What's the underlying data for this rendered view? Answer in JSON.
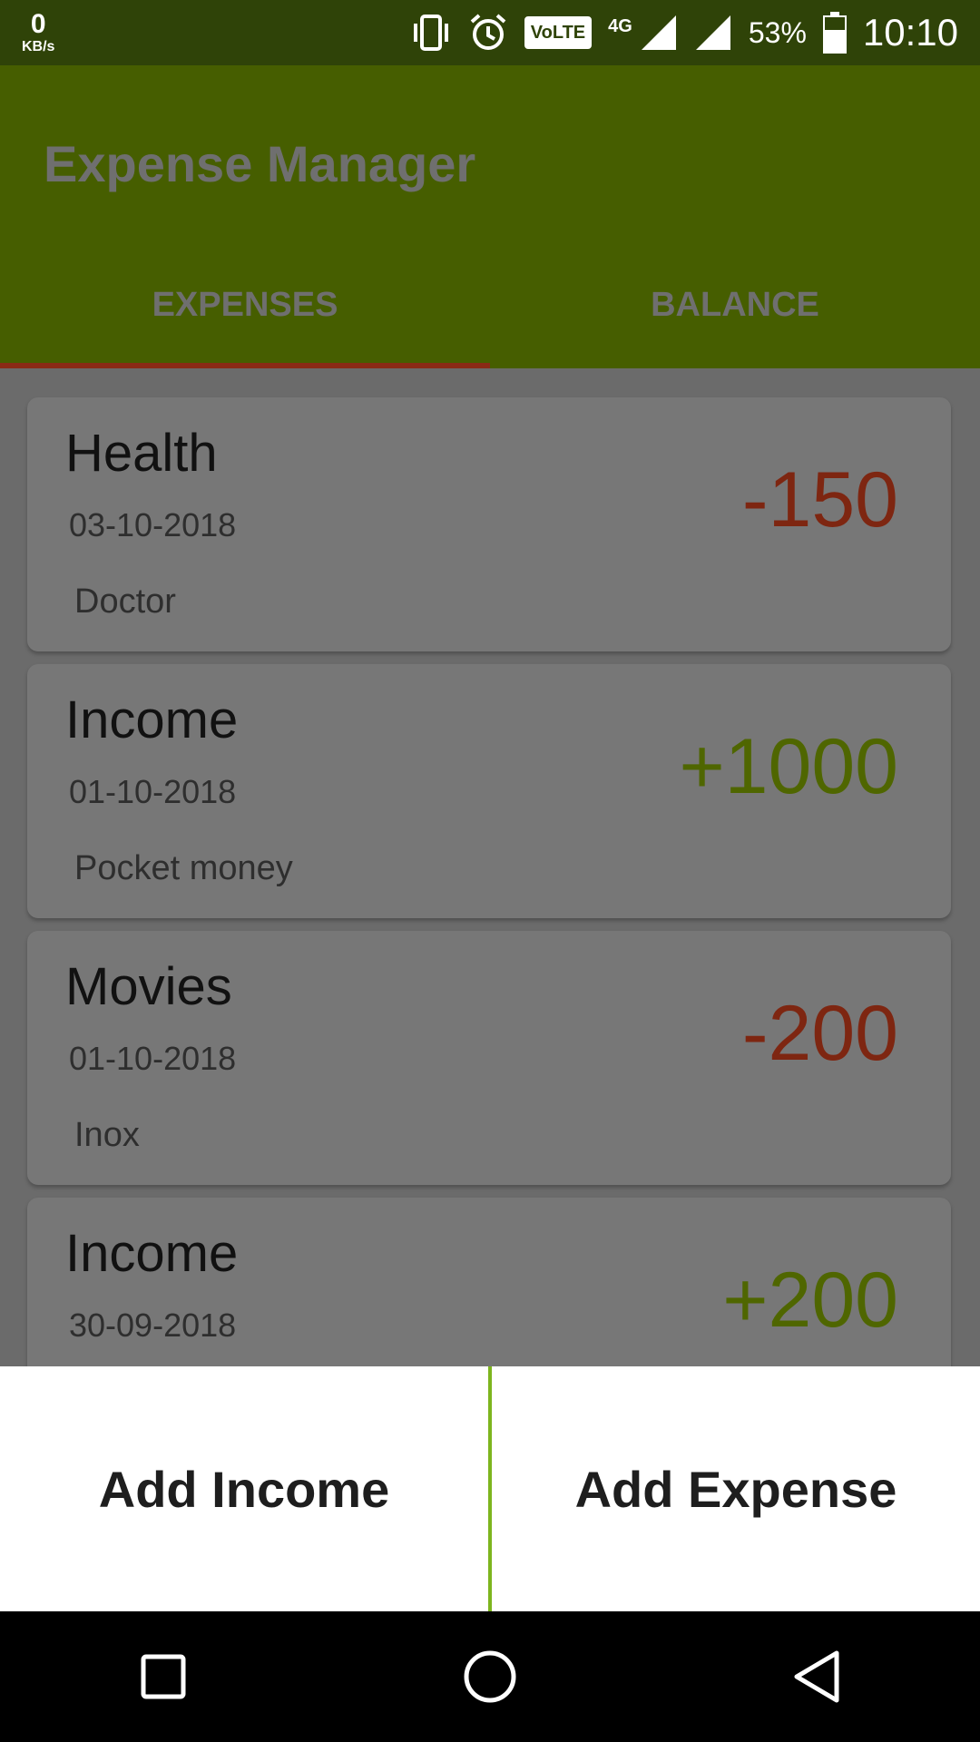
{
  "status_bar": {
    "net_speed": "0",
    "net_unit": "KB/s",
    "volte": "VoLTE",
    "network_type": "4G",
    "battery_percent": "53%",
    "time": "10:10",
    "icons": [
      "vibrate-icon",
      "alarm-icon",
      "volte-icon",
      "signal-4g-icon",
      "signal-icon",
      "battery-icon"
    ]
  },
  "app": {
    "title": "Expense Manager",
    "tabs": [
      {
        "label": "EXPENSES",
        "selected": true
      },
      {
        "label": "BALANCE",
        "selected": false
      }
    ]
  },
  "transactions": [
    {
      "category": "Health",
      "date": "03-10-2018",
      "note": "Doctor",
      "amount": "-150",
      "type": "expense"
    },
    {
      "category": "Income",
      "date": "01-10-2018",
      "note": "Pocket money",
      "amount": "+1000",
      "type": "income"
    },
    {
      "category": "Movies",
      "date": "01-10-2018",
      "note": "Inox",
      "amount": "-200",
      "type": "expense"
    },
    {
      "category": "Income",
      "date": "30-09-2018",
      "note": "",
      "amount": "+200",
      "type": "income"
    }
  ],
  "actions": {
    "add_income": "Add Income",
    "add_expense": "Add Expense"
  },
  "colors": {
    "status_bar": "#2f4308",
    "app_bar": "#465e00",
    "tab_indicator": "#8a2a16",
    "expense_amount": "#7e2611",
    "income_amount": "#4f6600",
    "divider": "#7db51e"
  },
  "nav": [
    "recents-icon",
    "home-icon",
    "back-icon"
  ]
}
